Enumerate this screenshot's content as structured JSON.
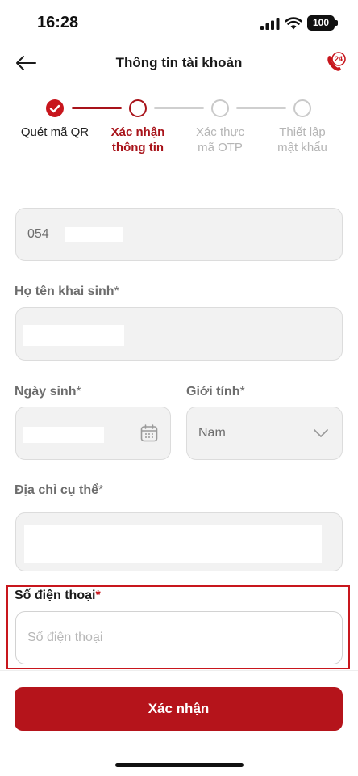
{
  "status_bar": {
    "time": "16:28",
    "battery": "100"
  },
  "header": {
    "title": "Thông tin tài khoản",
    "support_badge": "24"
  },
  "stepper": {
    "steps": [
      {
        "label_1": "Quét mã QR",
        "label_2": "",
        "state": "done"
      },
      {
        "label_1": "Xác nhận",
        "label_2": "thông tin",
        "state": "active"
      },
      {
        "label_1": "Xác thực",
        "label_2": "mã OTP",
        "state": "pending"
      },
      {
        "label_1": "Thiết lập",
        "label_2": "mật khẩu",
        "state": "pending"
      }
    ]
  },
  "form": {
    "id_number": {
      "value": "054"
    },
    "full_name": {
      "label": "Họ tên khai sinh",
      "required": "*"
    },
    "birth_date": {
      "label": "Ngày sinh",
      "required": "*"
    },
    "gender": {
      "label": "Giới tính",
      "required": "*",
      "value": "Nam"
    },
    "address": {
      "label": "Địa chỉ cụ thể",
      "required": "*"
    },
    "phone": {
      "label": "Số điện thoại",
      "required": "*",
      "placeholder": "Số điện thoại"
    }
  },
  "actions": {
    "confirm_label": "Xác nhận"
  },
  "colors": {
    "brand_red": "#b5141b",
    "active_step": "#a8131a",
    "pending_step": "#cfcfcf"
  }
}
